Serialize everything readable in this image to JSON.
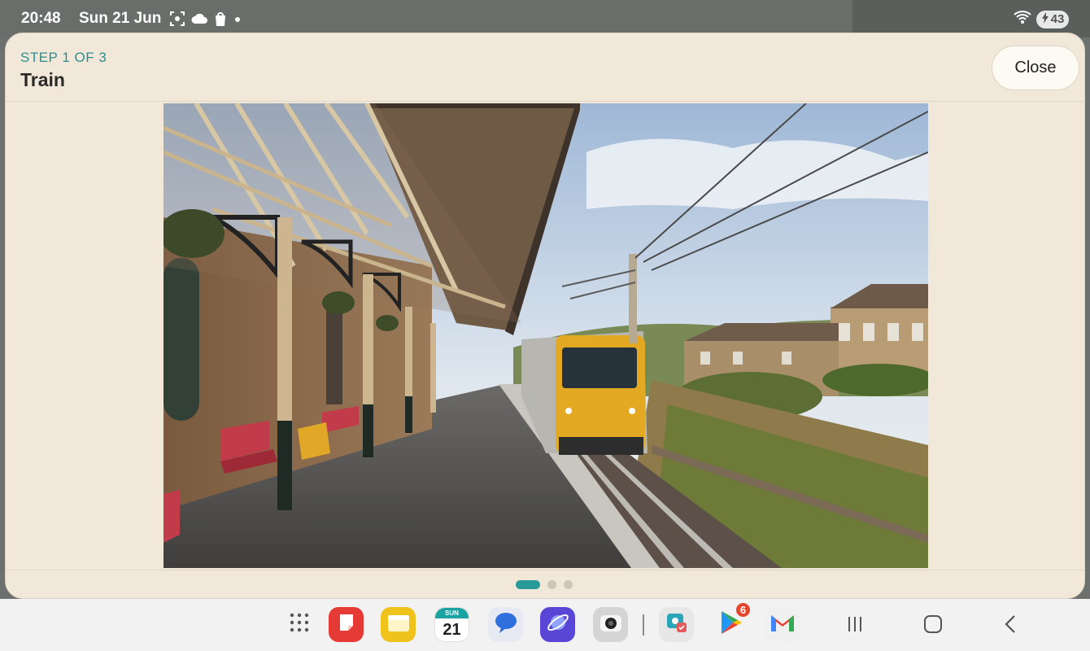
{
  "status_bar": {
    "time": "20:48",
    "date": "Sun 21 Jun",
    "left_icons": [
      "screenshot-icon",
      "cloud-icon",
      "shopping-bag-icon",
      "notification-dot-icon"
    ],
    "right_icons": [
      "wifi-icon"
    ],
    "battery_level": "43"
  },
  "dialog": {
    "step_label": "STEP 1 OF 3",
    "title": "Train",
    "close_label": "Close",
    "pager": {
      "current": 1,
      "total": 3
    },
    "image_subject": "train-station-photo"
  },
  "taskbar": {
    "apps": [
      {
        "name": "app-drawer",
        "icon": "grid-icon"
      },
      {
        "name": "notes",
        "icon": "notes-icon",
        "color": "#e63a36"
      },
      {
        "name": "files",
        "icon": "folder-icon",
        "color": "#f0c21c"
      },
      {
        "name": "calendar",
        "icon": "calendar-icon",
        "weekday": "SUN",
        "day": "21"
      },
      {
        "name": "messages",
        "icon": "chat-icon",
        "color": "#3a7be0"
      },
      {
        "name": "internet",
        "icon": "browser-icon",
        "color": "#5a46d6"
      },
      {
        "name": "camera",
        "icon": "camera-icon",
        "color": "#cfcfcf"
      },
      {
        "name": "gallery-edit",
        "icon": "photo-edit-icon",
        "color": "#2aa6b8"
      },
      {
        "name": "play-store",
        "icon": "play-store-icon",
        "badge": "6"
      },
      {
        "name": "gmail",
        "icon": "gmail-icon"
      }
    ],
    "nav": [
      "recents-icon",
      "home-icon",
      "back-icon"
    ]
  }
}
